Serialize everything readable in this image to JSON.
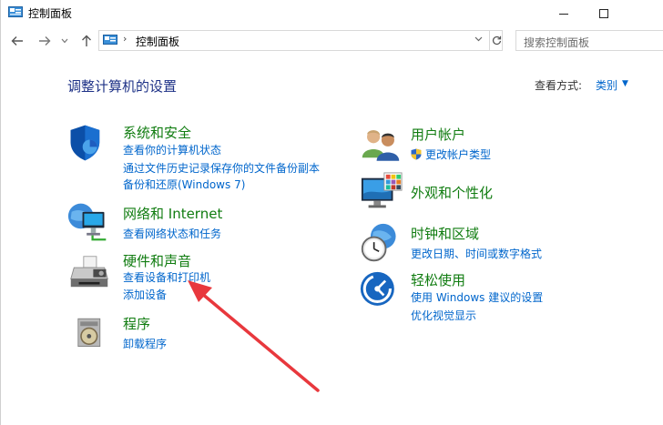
{
  "window": {
    "title": "控制面板"
  },
  "nav": {
    "address": "控制面板",
    "search_placeholder": "搜索控制面板"
  },
  "content": {
    "heading": "调整计算机的设置",
    "view_by_label": "查看方式:",
    "view_by_value": "类别"
  },
  "categories": {
    "system_security": {
      "title": "系统和安全",
      "links": [
        "查看你的计算机状态",
        "通过文件历史记录保存你的文件备份副本",
        "备份和还原(Windows 7)"
      ]
    },
    "network": {
      "title": "网络和 Internet",
      "links": [
        "查看网络状态和任务"
      ]
    },
    "hardware": {
      "title": "硬件和声音",
      "links": [
        "查看设备和打印机",
        "添加设备"
      ]
    },
    "programs": {
      "title": "程序",
      "links": [
        "卸载程序"
      ]
    },
    "user_accounts": {
      "title": "用户帐户",
      "links": [
        "更改帐户类型"
      ]
    },
    "appearance": {
      "title": "外观和个性化",
      "links": []
    },
    "clock": {
      "title": "时钟和区域",
      "links": [
        "更改日期、时间或数字格式"
      ]
    },
    "ease": {
      "title": "轻松使用",
      "links": [
        "使用 Windows 建议的设置",
        "优化视觉显示"
      ]
    }
  },
  "colors": {
    "heading": "#1e3287",
    "category_title": "#107c10",
    "link": "#0066cc",
    "annotation_arrow": "#e8383d"
  }
}
